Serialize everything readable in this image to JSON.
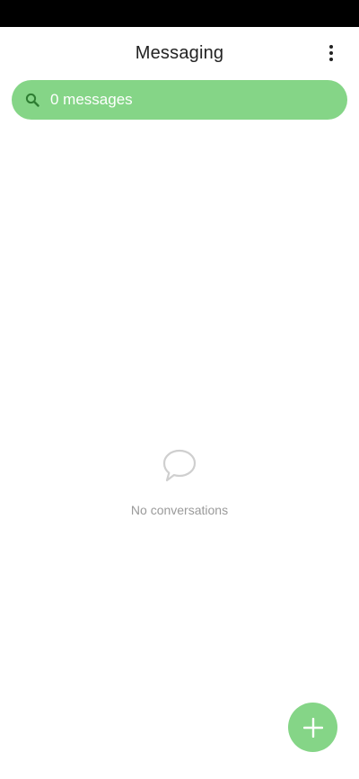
{
  "header": {
    "title": "Messaging",
    "more_icon": "more-vert-icon"
  },
  "search": {
    "label": "0 messages",
    "icon": "search-icon"
  },
  "empty_state": {
    "icon": "chat-bubble-icon",
    "text": "No conversations"
  },
  "fab": {
    "icon": "plus-icon"
  },
  "colors": {
    "accent": "#85d587",
    "status_bar": "#000000",
    "title_text": "#222222",
    "muted_text": "#9a9a9a"
  }
}
